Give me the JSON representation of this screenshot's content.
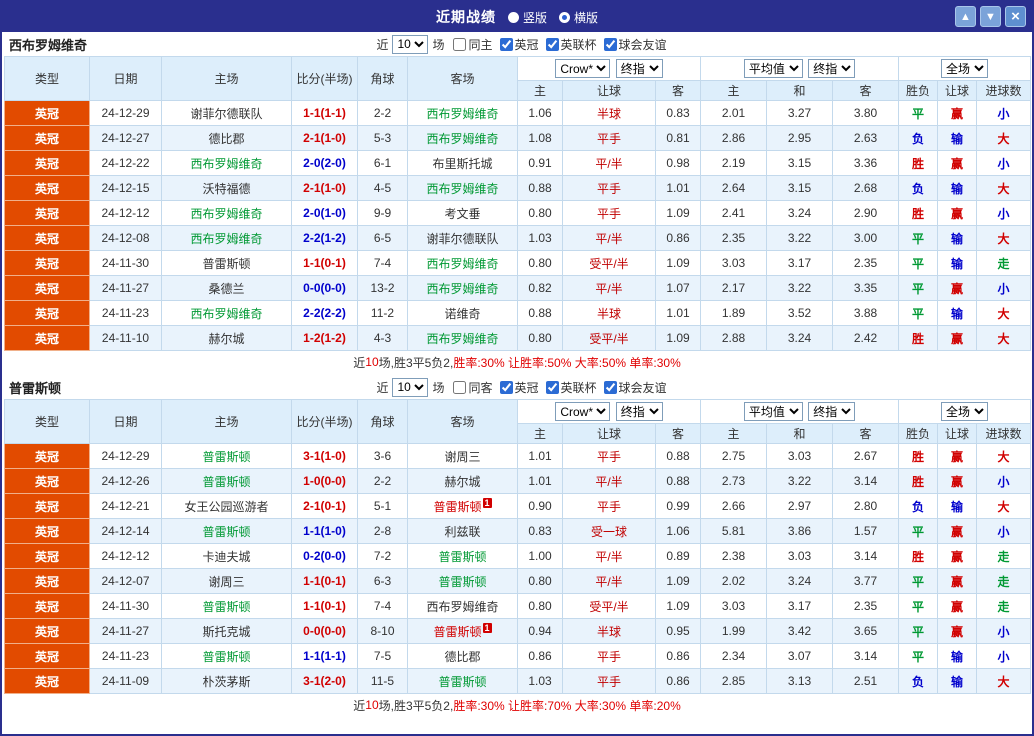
{
  "window": {
    "title": "近期战绩",
    "view_options": [
      {
        "label": "竖版",
        "selected": false
      },
      {
        "label": "横版",
        "selected": true
      }
    ],
    "controls": {
      "up": "▲",
      "down": "▼",
      "close": "×"
    }
  },
  "table_headers": {
    "base": [
      "类型",
      "日期",
      "主场",
      "比分(半场)",
      "角球",
      "客场"
    ],
    "group1": {
      "select1": "Crow*",
      "select2": "终指",
      "cols": [
        "主",
        "让球",
        "客"
      ]
    },
    "group2": {
      "select1": "平均值",
      "select2": "终指",
      "cols": [
        "主",
        "和",
        "客"
      ]
    },
    "group3": {
      "select1": "全场",
      "cols": [
        "胜负",
        "让球",
        "进球数"
      ]
    }
  },
  "colors": {
    "navy_header": "#2a2f8e",
    "type_cell_bg": "#e24b00",
    "row_alt_bg": "#e9f3fc",
    "header_bg": "#ddeefb",
    "handicap": "#c00000",
    "team": {
      "focal": "#009933",
      "normal": "#333333",
      "redcard": "#d10000"
    },
    "values": {
      "胜": "#d10000",
      "平": "#009933",
      "负": "#0000cc",
      "赢": "#d10000",
      "输": "#0000cc",
      "大": "#d10000",
      "小": "#0000cc",
      "走": "#009933"
    }
  },
  "sections": [
    {
      "team": "西布罗姆维奇",
      "filter": {
        "prefix": "近",
        "count": "10",
        "suffix": "场",
        "checks": [
          {
            "label": "同主",
            "checked": false
          },
          {
            "label": "英冠",
            "checked": true
          },
          {
            "label": "英联杯",
            "checked": true
          },
          {
            "label": "球会友谊",
            "checked": true
          }
        ]
      },
      "rows": [
        {
          "league": "英冠",
          "date": "24-12-29",
          "home": {
            "name": "谢菲尔德联队",
            "style": "normal"
          },
          "score": {
            "text": "1-1(1-1)",
            "color": "#d10000"
          },
          "corners": "2-2",
          "away": {
            "name": "西布罗姆维奇",
            "style": "focal"
          },
          "odds": [
            "1.06",
            "半球",
            "0.83"
          ],
          "avg": [
            "2.01",
            "3.27",
            "3.80"
          ],
          "result": "平",
          "let_result": "赢",
          "goal_result": "小"
        },
        {
          "league": "英冠",
          "date": "24-12-27",
          "home": {
            "name": "德比郡",
            "style": "normal"
          },
          "score": {
            "text": "2-1(1-0)",
            "color": "#d10000"
          },
          "corners": "5-3",
          "away": {
            "name": "西布罗姆维奇",
            "style": "focal"
          },
          "odds": [
            "1.08",
            "平手",
            "0.81"
          ],
          "avg": [
            "2.86",
            "2.95",
            "2.63"
          ],
          "result": "负",
          "let_result": "输",
          "goal_result": "大"
        },
        {
          "league": "英冠",
          "date": "24-12-22",
          "home": {
            "name": "西布罗姆维奇",
            "style": "focal"
          },
          "score": {
            "text": "2-0(2-0)",
            "color": "#0000cc"
          },
          "corners": "6-1",
          "away": {
            "name": "布里斯托城",
            "style": "normal"
          },
          "odds": [
            "0.91",
            "平/半",
            "0.98"
          ],
          "avg": [
            "2.19",
            "3.15",
            "3.36"
          ],
          "result": "胜",
          "let_result": "赢",
          "goal_result": "小"
        },
        {
          "league": "英冠",
          "date": "24-12-15",
          "home": {
            "name": "沃特福德",
            "style": "normal"
          },
          "score": {
            "text": "2-1(1-0)",
            "color": "#d10000"
          },
          "corners": "4-5",
          "away": {
            "name": "西布罗姆维奇",
            "style": "focal"
          },
          "odds": [
            "0.88",
            "平手",
            "1.01"
          ],
          "avg": [
            "2.64",
            "3.15",
            "2.68"
          ],
          "result": "负",
          "let_result": "输",
          "goal_result": "大"
        },
        {
          "league": "英冠",
          "date": "24-12-12",
          "home": {
            "name": "西布罗姆维奇",
            "style": "focal"
          },
          "score": {
            "text": "2-0(1-0)",
            "color": "#0000cc"
          },
          "corners": "9-9",
          "away": {
            "name": "考文垂",
            "style": "normal"
          },
          "odds": [
            "0.80",
            "平手",
            "1.09"
          ],
          "avg": [
            "2.41",
            "3.24",
            "2.90"
          ],
          "result": "胜",
          "let_result": "赢",
          "goal_result": "小"
        },
        {
          "league": "英冠",
          "date": "24-12-08",
          "home": {
            "name": "西布罗姆维奇",
            "style": "focal"
          },
          "score": {
            "text": "2-2(1-2)",
            "color": "#0000cc"
          },
          "corners": "6-5",
          "away": {
            "name": "谢菲尔德联队",
            "style": "normal"
          },
          "odds": [
            "1.03",
            "平/半",
            "0.86"
          ],
          "avg": [
            "2.35",
            "3.22",
            "3.00"
          ],
          "result": "平",
          "let_result": "输",
          "goal_result": "大"
        },
        {
          "league": "英冠",
          "date": "24-11-30",
          "home": {
            "name": "普雷斯顿",
            "style": "normal"
          },
          "score": {
            "text": "1-1(0-1)",
            "color": "#d10000"
          },
          "corners": "7-4",
          "away": {
            "name": "西布罗姆维奇",
            "style": "focal"
          },
          "odds": [
            "0.80",
            "受平/半",
            "1.09"
          ],
          "avg": [
            "3.03",
            "3.17",
            "2.35"
          ],
          "result": "平",
          "let_result": "输",
          "goal_result": "走"
        },
        {
          "league": "英冠",
          "date": "24-11-27",
          "home": {
            "name": "桑德兰",
            "style": "normal"
          },
          "score": {
            "text": "0-0(0-0)",
            "color": "#0000cc"
          },
          "corners": "13-2",
          "away": {
            "name": "西布罗姆维奇",
            "style": "focal"
          },
          "odds": [
            "0.82",
            "平/半",
            "1.07"
          ],
          "avg": [
            "2.17",
            "3.22",
            "3.35"
          ],
          "result": "平",
          "let_result": "赢",
          "goal_result": "小"
        },
        {
          "league": "英冠",
          "date": "24-11-23",
          "home": {
            "name": "西布罗姆维奇",
            "style": "focal"
          },
          "score": {
            "text": "2-2(2-2)",
            "color": "#0000cc"
          },
          "corners": "11-2",
          "away": {
            "name": "诺维奇",
            "style": "normal"
          },
          "odds": [
            "0.88",
            "半球",
            "1.01"
          ],
          "avg": [
            "1.89",
            "3.52",
            "3.88"
          ],
          "result": "平",
          "let_result": "输",
          "goal_result": "大"
        },
        {
          "league": "英冠",
          "date": "24-11-10",
          "home": {
            "name": "赫尔城",
            "style": "normal"
          },
          "score": {
            "text": "1-2(1-2)",
            "color": "#d10000"
          },
          "corners": "4-3",
          "away": {
            "name": "西布罗姆维奇",
            "style": "focal"
          },
          "odds": [
            "0.80",
            "受平/半",
            "1.09"
          ],
          "avg": [
            "2.88",
            "3.24",
            "2.42"
          ],
          "result": "胜",
          "let_result": "赢",
          "goal_result": "大"
        }
      ],
      "footer": [
        {
          "text": "近",
          "color": "#333333"
        },
        {
          "text": "10",
          "color": "#e00000"
        },
        {
          "text": "场,胜3平5负2, ",
          "color": "#333333"
        },
        {
          "text": "胜率:30% 让胜率:50% 大率:50% 单率:30%",
          "color": "#e00000"
        }
      ]
    },
    {
      "team": "普雷斯顿",
      "filter": {
        "prefix": "近",
        "count": "10",
        "suffix": "场",
        "checks": [
          {
            "label": "同客",
            "checked": false
          },
          {
            "label": "英冠",
            "checked": true
          },
          {
            "label": "英联杯",
            "checked": true
          },
          {
            "label": "球会友谊",
            "checked": true
          }
        ]
      },
      "rows": [
        {
          "league": "英冠",
          "date": "24-12-29",
          "home": {
            "name": "普雷斯顿",
            "style": "focal"
          },
          "score": {
            "text": "3-1(1-0)",
            "color": "#d10000"
          },
          "corners": "3-6",
          "away": {
            "name": "谢周三",
            "style": "normal"
          },
          "odds": [
            "1.01",
            "平手",
            "0.88"
          ],
          "avg": [
            "2.75",
            "3.03",
            "2.67"
          ],
          "result": "胜",
          "let_result": "赢",
          "goal_result": "大"
        },
        {
          "league": "英冠",
          "date": "24-12-26",
          "home": {
            "name": "普雷斯顿",
            "style": "focal"
          },
          "score": {
            "text": "1-0(0-0)",
            "color": "#d10000"
          },
          "corners": "2-2",
          "away": {
            "name": "赫尔城",
            "style": "normal"
          },
          "odds": [
            "1.01",
            "平/半",
            "0.88"
          ],
          "avg": [
            "2.73",
            "3.22",
            "3.14"
          ],
          "result": "胜",
          "let_result": "赢",
          "goal_result": "小"
        },
        {
          "league": "英冠",
          "date": "24-12-21",
          "home": {
            "name": "女王公园巡游者",
            "style": "normal"
          },
          "score": {
            "text": "2-1(0-1)",
            "color": "#d10000"
          },
          "corners": "5-1",
          "away": {
            "name": "普雷斯顿",
            "style": "redcard",
            "badge": "1"
          },
          "odds": [
            "0.90",
            "平手",
            "0.99"
          ],
          "avg": [
            "2.66",
            "2.97",
            "2.80"
          ],
          "result": "负",
          "let_result": "输",
          "goal_result": "大"
        },
        {
          "league": "英冠",
          "date": "24-12-14",
          "home": {
            "name": "普雷斯顿",
            "style": "focal"
          },
          "score": {
            "text": "1-1(1-0)",
            "color": "#0000cc"
          },
          "corners": "2-8",
          "away": {
            "name": "利兹联",
            "style": "normal"
          },
          "odds": [
            "0.83",
            "受一球",
            "1.06"
          ],
          "avg": [
            "5.81",
            "3.86",
            "1.57"
          ],
          "result": "平",
          "let_result": "赢",
          "goal_result": "小"
        },
        {
          "league": "英冠",
          "date": "24-12-12",
          "home": {
            "name": "卡迪夫城",
            "style": "normal"
          },
          "score": {
            "text": "0-2(0-0)",
            "color": "#0000cc"
          },
          "corners": "7-2",
          "away": {
            "name": "普雷斯顿",
            "style": "focal"
          },
          "odds": [
            "1.00",
            "平/半",
            "0.89"
          ],
          "avg": [
            "2.38",
            "3.03",
            "3.14"
          ],
          "result": "胜",
          "let_result": "赢",
          "goal_result": "走"
        },
        {
          "league": "英冠",
          "date": "24-12-07",
          "home": {
            "name": "谢周三",
            "style": "normal"
          },
          "score": {
            "text": "1-1(0-1)",
            "color": "#d10000"
          },
          "corners": "6-3",
          "away": {
            "name": "普雷斯顿",
            "style": "focal"
          },
          "odds": [
            "0.80",
            "平/半",
            "1.09"
          ],
          "avg": [
            "2.02",
            "3.24",
            "3.77"
          ],
          "result": "平",
          "let_result": "赢",
          "goal_result": "走"
        },
        {
          "league": "英冠",
          "date": "24-11-30",
          "home": {
            "name": "普雷斯顿",
            "style": "focal"
          },
          "score": {
            "text": "1-1(0-1)",
            "color": "#d10000"
          },
          "corners": "7-4",
          "away": {
            "name": "西布罗姆维奇",
            "style": "normal"
          },
          "odds": [
            "0.80",
            "受平/半",
            "1.09"
          ],
          "avg": [
            "3.03",
            "3.17",
            "2.35"
          ],
          "result": "平",
          "let_result": "赢",
          "goal_result": "走"
        },
        {
          "league": "英冠",
          "date": "24-11-27",
          "home": {
            "name": "斯托克城",
            "style": "normal"
          },
          "score": {
            "text": "0-0(0-0)",
            "color": "#d10000"
          },
          "corners": "8-10",
          "away": {
            "name": "普雷斯顿",
            "style": "redcard",
            "badge": "1"
          },
          "odds": [
            "0.94",
            "半球",
            "0.95"
          ],
          "avg": [
            "1.99",
            "3.42",
            "3.65"
          ],
          "result": "平",
          "let_result": "赢",
          "goal_result": "小"
        },
        {
          "league": "英冠",
          "date": "24-11-23",
          "home": {
            "name": "普雷斯顿",
            "style": "focal"
          },
          "score": {
            "text": "1-1(1-1)",
            "color": "#0000cc"
          },
          "corners": "7-5",
          "away": {
            "name": "德比郡",
            "style": "normal"
          },
          "odds": [
            "0.86",
            "平手",
            "0.86"
          ],
          "avg": [
            "2.34",
            "3.07",
            "3.14"
          ],
          "result": "平",
          "let_result": "输",
          "goal_result": "小"
        },
        {
          "league": "英冠",
          "date": "24-11-09",
          "home": {
            "name": "朴茨茅斯",
            "style": "normal"
          },
          "score": {
            "text": "3-1(2-0)",
            "color": "#d10000"
          },
          "corners": "11-5",
          "away": {
            "name": "普雷斯顿",
            "style": "focal"
          },
          "odds": [
            "1.03",
            "平手",
            "0.86"
          ],
          "avg": [
            "2.85",
            "3.13",
            "2.51"
          ],
          "result": "负",
          "let_result": "输",
          "goal_result": "大"
        }
      ],
      "footer": [
        {
          "text": "近",
          "color": "#333333"
        },
        {
          "text": "10",
          "color": "#e00000"
        },
        {
          "text": "场,胜3平5负2, ",
          "color": "#333333"
        },
        {
          "text": "胜率:30% 让胜率:70% 大率:30% 单率:20%",
          "color": "#e00000"
        }
      ]
    }
  ]
}
